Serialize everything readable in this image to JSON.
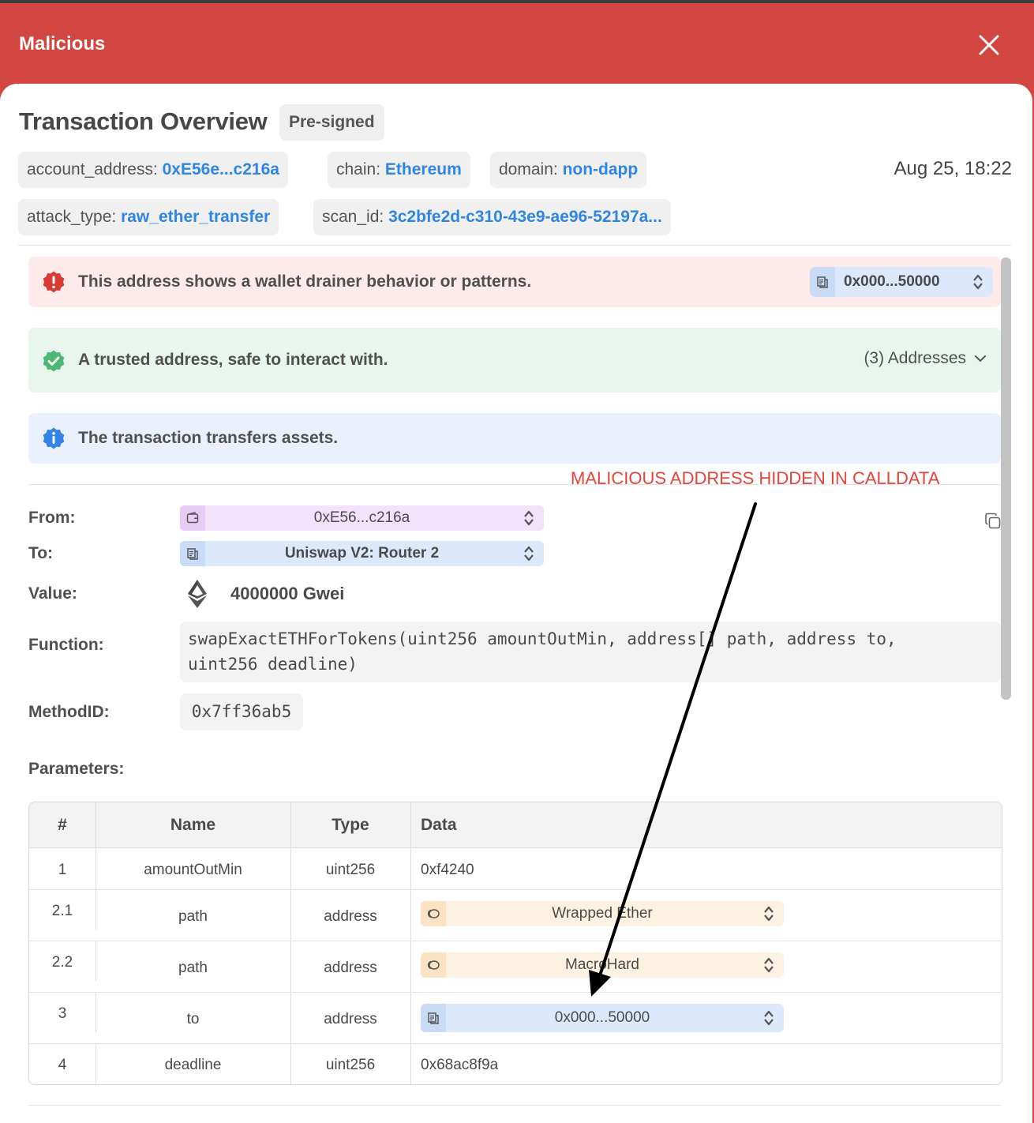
{
  "header": {
    "title": "Malicious"
  },
  "overview": {
    "title": "Transaction Overview",
    "badge": "Pre-signed",
    "date": "Aug 25, 18:22",
    "meta": [
      {
        "key": "account_address:",
        "value": "0xE56e...c216a"
      },
      {
        "key": "chain:",
        "value": "Ethereum"
      },
      {
        "key": "domain:",
        "value": "non-dapp"
      },
      {
        "key": "attack_type:",
        "value": "raw_ether_transfer"
      },
      {
        "key": "scan_id:",
        "value": "3c2bfe2d-c310-43e9-ae96-52197a..."
      }
    ]
  },
  "alerts": {
    "danger": {
      "text": "This address shows a wallet drainer behavior or patterns.",
      "address": "0x000...50000"
    },
    "safe": {
      "text": "A trusted address, safe to interact with.",
      "dropdown": "(3) Addresses"
    },
    "info": {
      "text": "The transaction transfers assets."
    }
  },
  "annotation": {
    "text": "MALICIOUS ADDRESS HIDDEN IN CALLDATA"
  },
  "details": {
    "from_label": "From:",
    "from_value": "0xE56...c216a",
    "to_label": "To:",
    "to_value": "Uniswap V2: Router 2",
    "value_label": "Value:",
    "value": "4000000 Gwei",
    "function_label": "Function:",
    "function_line1": "swapExactETHForTokens(uint256 amountOutMin, address[] path, address to,",
    "function_line2": "uint256 deadline)",
    "method_label": "MethodID:",
    "method_value": "0x7ff36ab5",
    "params_label": "Parameters:"
  },
  "table": {
    "headers": [
      "#",
      "Name",
      "Type",
      "Data"
    ],
    "rows": [
      {
        "num": "1",
        "name": "amountOutMin",
        "type": "uint256",
        "data": "0xf4240"
      },
      {
        "num": "2.1",
        "name": "path",
        "type": "address",
        "data": "Wrapped Ether"
      },
      {
        "num": "2.2",
        "name": "path",
        "type": "address",
        "data": "MacroHard"
      },
      {
        "num": "3",
        "name": "to",
        "type": "address",
        "data": "0x000...50000"
      },
      {
        "num": "4",
        "name": "deadline",
        "type": "uint256",
        "data": "0x68ac8f9a"
      }
    ]
  },
  "colors": {
    "header_red": "#d24541",
    "link_blue": "#2f85e4",
    "danger_bg": "#fcebea",
    "safe_bg": "#e9f6ee",
    "info_bg": "#eaf1fd",
    "annotation_red": "#e8433a"
  }
}
